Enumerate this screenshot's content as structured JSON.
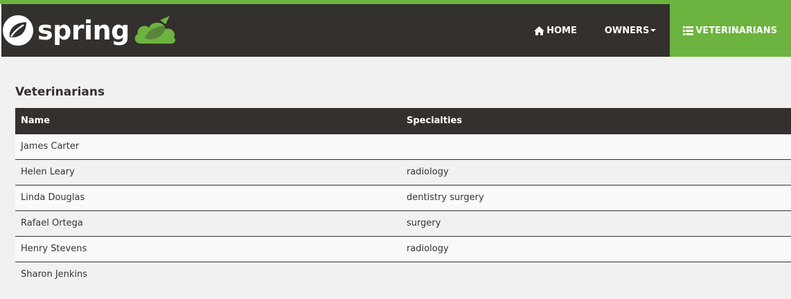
{
  "brand": {
    "name": "spring",
    "logo_icon": "spring-leaf-icon",
    "cloud_icon": "petclinic-cloud-icon"
  },
  "nav": {
    "home": {
      "label": "Home",
      "icon": "home-icon"
    },
    "owners": {
      "label": "Owners",
      "icon": "caret-down-icon"
    },
    "veterinarians": {
      "label": "Veterinarians",
      "icon": "list-icon",
      "active": true
    }
  },
  "colors": {
    "nav_bg": "#34302d",
    "accent": "#6db33f",
    "page_bg": "#f1f1f1"
  },
  "main": {
    "title": "Veterinarians",
    "table": {
      "headers": [
        "Name",
        "Specialties"
      ],
      "rows": [
        {
          "name": "James Carter",
          "specialties": ""
        },
        {
          "name": "Helen Leary",
          "specialties": "radiology"
        },
        {
          "name": "Linda Douglas",
          "specialties": "dentistry surgery"
        },
        {
          "name": "Rafael Ortega",
          "specialties": "surgery"
        },
        {
          "name": "Henry Stevens",
          "specialties": "radiology"
        },
        {
          "name": "Sharon Jenkins",
          "specialties": ""
        }
      ]
    }
  }
}
